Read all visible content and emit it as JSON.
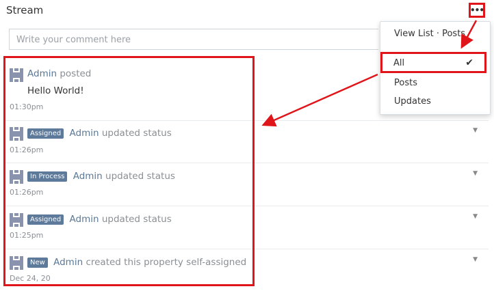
{
  "panel": {
    "title": "Stream"
  },
  "menu": {
    "icon": "more-icon",
    "label": "•••"
  },
  "comment": {
    "placeholder": "Write your comment here"
  },
  "dropdown": {
    "header": "View List · Posts",
    "items": [
      {
        "label": "All",
        "checked": true,
        "check": "✔"
      },
      {
        "label": "Posts"
      },
      {
        "label": "Updates"
      }
    ]
  },
  "stream": [
    {
      "user": "Admin",
      "action": "posted",
      "text": "Hello World!",
      "time": "01:30pm"
    },
    {
      "badge": "Assigned",
      "user": "Admin",
      "action": "updated status",
      "time": "01:26pm",
      "chev": "▼"
    },
    {
      "badge": "In Process",
      "user": "Admin",
      "action": "updated status",
      "time": "01:26pm",
      "chev": "▼"
    },
    {
      "badge": "Assigned",
      "user": "Admin",
      "action": "updated status",
      "time": "01:25pm",
      "chev": "▼"
    },
    {
      "badge": "New",
      "user": "Admin",
      "action": "created this property self-assigned",
      "time": "Dec 24, 20",
      "chev": "▼"
    }
  ],
  "colors": {
    "highlight": "#e0151a",
    "badge": "#5d7a9a",
    "link": "#5a7896"
  }
}
